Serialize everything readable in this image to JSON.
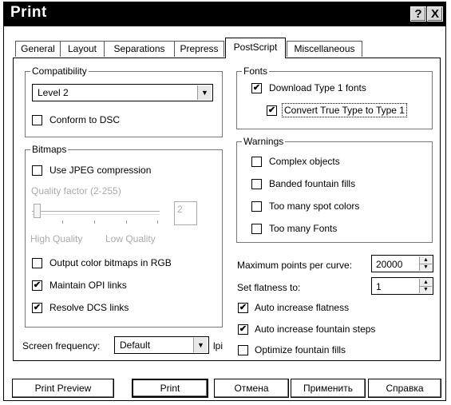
{
  "window": {
    "title": "Print",
    "help_button": "?",
    "close_button": "X"
  },
  "tabs": [
    {
      "label": "General",
      "active": false
    },
    {
      "label": "Layout",
      "active": false
    },
    {
      "label": "Separations",
      "active": false
    },
    {
      "label": "Prepress",
      "active": false
    },
    {
      "label": "PostScript",
      "active": true
    },
    {
      "label": "Miscellaneous",
      "active": false
    }
  ],
  "compatibility": {
    "group_label": "Compatibility",
    "level_value": "Level 2",
    "conform_dsc_label": "Conform to DSC",
    "conform_dsc_checked": false
  },
  "bitmaps": {
    "group_label": "Bitmaps",
    "use_jpeg_label": "Use JPEG compression",
    "use_jpeg_checked": false,
    "quality_factor_label": "Quality factor (2-255)",
    "quality_value": "2",
    "high_quality_label": "High Quality",
    "low_quality_label": "Low Quality",
    "output_rgb_label": "Output color bitmaps in RGB",
    "output_rgb_checked": false,
    "maintain_opi_label": "Maintain OPI links",
    "maintain_opi_checked": true,
    "resolve_dcs_label": "Resolve DCS links",
    "resolve_dcs_checked": true
  },
  "screen_frequency": {
    "label": "Screen frequency:",
    "value": "Default",
    "unit": "lpi"
  },
  "fonts": {
    "group_label": "Fonts",
    "download_type1_label": "Download Type 1 fonts",
    "download_type1_checked": true,
    "convert_truetype_label": "Convert True Type to Type 1",
    "convert_truetype_checked": true
  },
  "warnings": {
    "group_label": "Warnings",
    "complex_objects_label": "Complex objects",
    "banded_fills_label": "Banded fountain fills",
    "spot_colors_label": "Too many spot colors",
    "too_many_fonts_label": "Too many Fonts"
  },
  "curve": {
    "max_points_label": "Maximum points per curve:",
    "max_points_value": "20000",
    "flatness_label": "Set flatness to:",
    "flatness_value": "1",
    "auto_flatness_label": "Auto increase flatness",
    "auto_flatness_checked": true,
    "auto_fountain_label": "Auto increase fountain steps",
    "auto_fountain_checked": true,
    "optimize_fountain_label": "Optimize fountain fills",
    "optimize_fountain_checked": false
  },
  "buttons": {
    "print_preview": "Print Preview",
    "print": "Print",
    "cancel": "Отмена",
    "apply": "Применить",
    "help": "Справка"
  },
  "check_mark": "✔"
}
